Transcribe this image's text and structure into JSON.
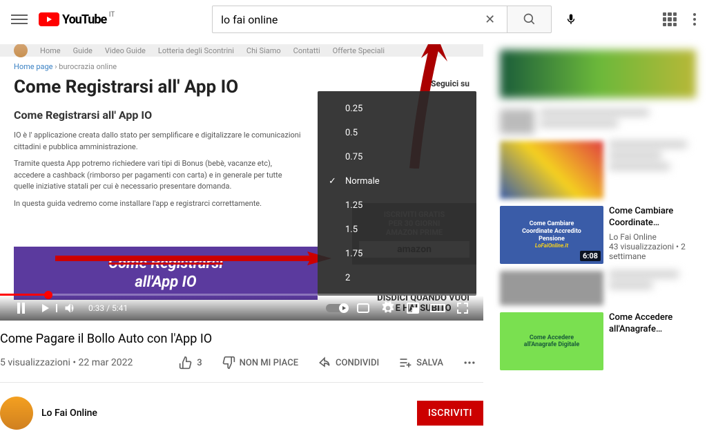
{
  "header": {
    "logo_text": "YouTube",
    "region": "IT",
    "search_value": "lo fai online"
  },
  "player": {
    "site_nav": [
      "Home",
      "Guide",
      "Video Guide",
      "Lotteria degli Scontrini",
      "Chi Siamo",
      "Contatti",
      "Offerte Speciali"
    ],
    "breadcrumb_home": "Home page",
    "breadcrumb_sep": " › ",
    "breadcrumb_cat": "burocrazia online",
    "article_title": "Come Registrarsi all' App IO",
    "article_subtitle": "Come Registrarsi all' App IO",
    "para1": "IO è l' applicazione creata dallo stato per semplificare e digitalizzare le comunicazioni cittadini e pubblica amministrazione.",
    "para2": "Tramite questa App potremo richiedere vari tipi di Bonus (bebè, vacanze etc), accedere a cashback (rimborso per pagamenti con carta) e in generale per tutte quelle iniziative statali per cui è necessario presentare domanda.",
    "para3": "In questa guida vedremo come installare l'app e registrarci correttamente.",
    "seguici": "Seguici su",
    "banner_l1": "Come Registrarsi",
    "banner_l2": "all'App IO",
    "amazon_l1": "ISCRIVITI GRATIS",
    "amazon_l2": "PER 30 GIORNI",
    "amazon_l3": "AMAZON PRIME",
    "amazon_brand": "amazon",
    "disdici_l1": "DISDICI QUANDO VUOI",
    "disdici_l2": "E HAI SUBITO",
    "time": "0:33 / 5:41"
  },
  "speed_menu": [
    "0.25",
    "0.5",
    "0.75",
    "Normale",
    "1.25",
    "1.5",
    "1.75",
    "2"
  ],
  "speed_selected": "Normale",
  "video": {
    "title": "Come Pagare il Bollo Auto con l'App IO",
    "views": "5 visualizzazioni",
    "date": "22 mar 2022",
    "likes": "3",
    "dislike_label": "NON MI PIACE",
    "share_label": "CONDIVIDI",
    "save_label": "SALVA"
  },
  "channel": {
    "name": "Lo Fai Online",
    "subscribe": "ISCRIVITI"
  },
  "sidebar": {
    "v1": {
      "thumb_l1": "Come Cambiare",
      "thumb_l2": "Coordinate Accredito",
      "thumb_l3": "Pensione",
      "thumb_site": "LoFaiOnline.it",
      "duration": "6:08",
      "title": "Come Cambiare Coordinate Pagamento Pensione",
      "channel": "Lo Fai Online",
      "meta": "43 visualizzazioni • 2 settimane"
    },
    "v2": {
      "thumb_l1": "Come Accedere",
      "thumb_l2": "all'Anagrafe Digitale",
      "title": "Come Accedere all'Anagrafe Nazionale Digitale"
    }
  }
}
